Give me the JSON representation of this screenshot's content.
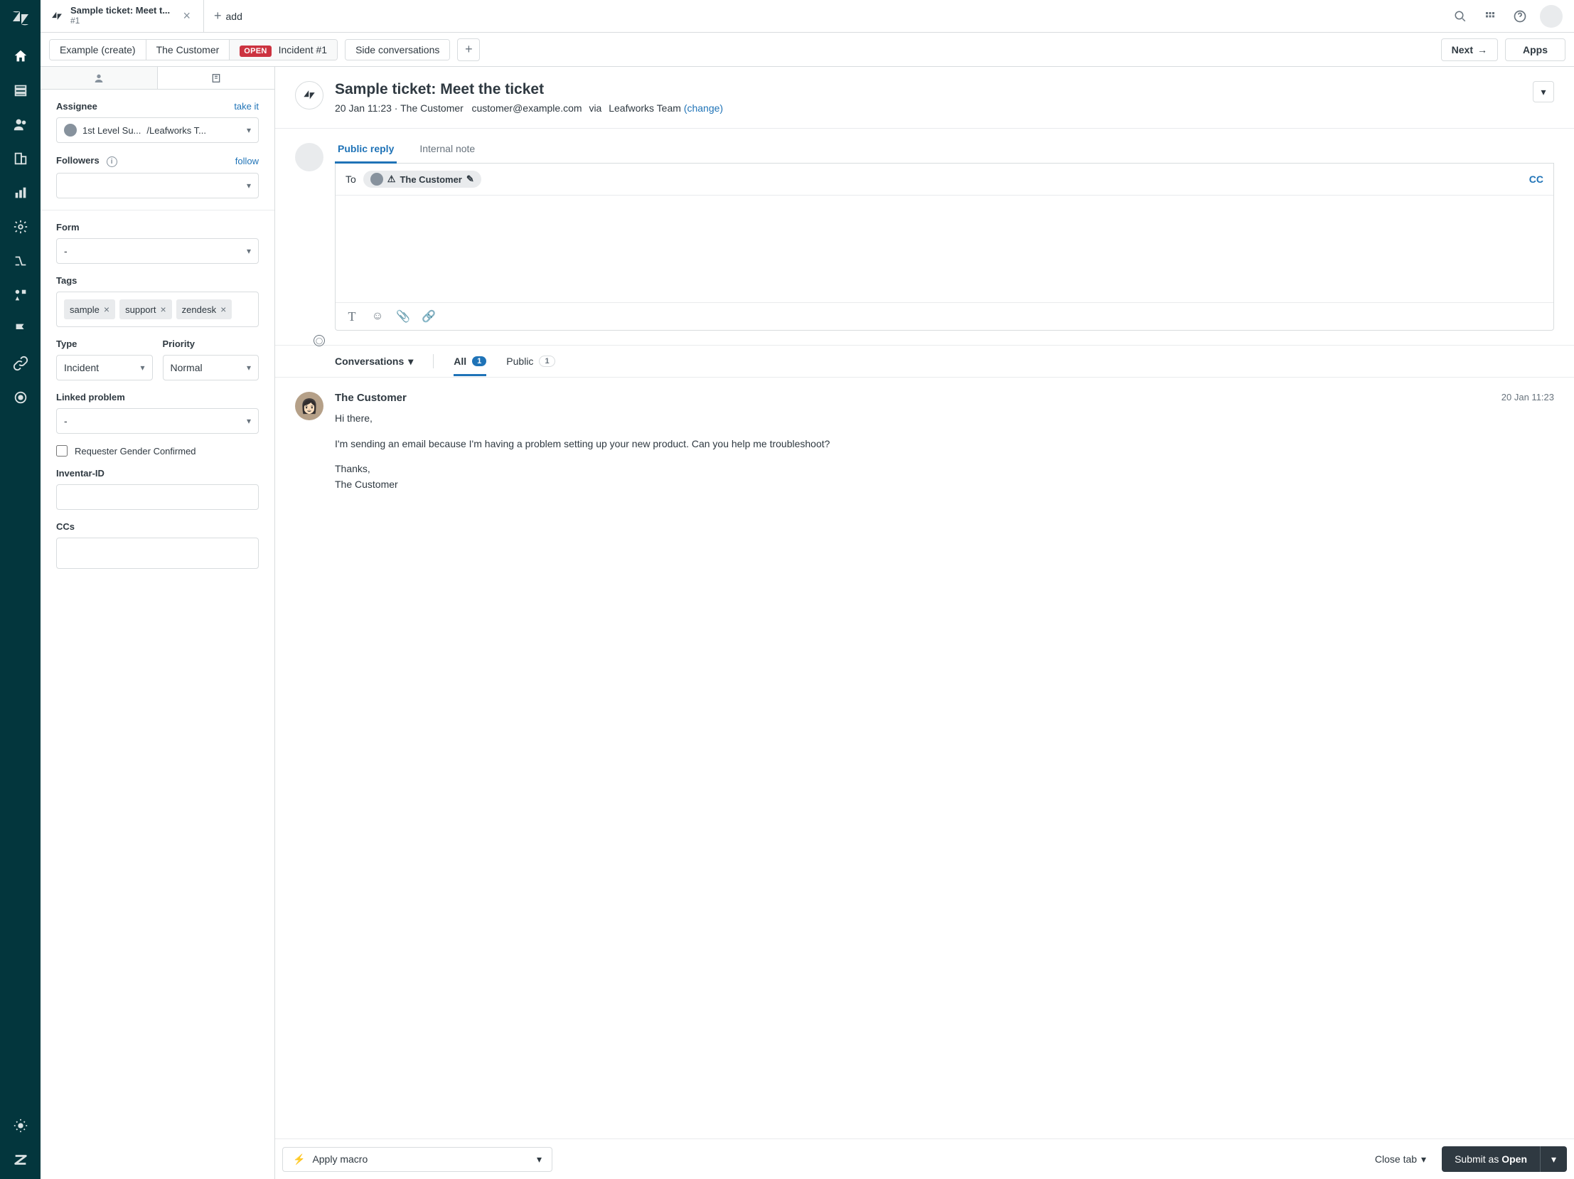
{
  "tab": {
    "title": "Sample ticket: Meet t...",
    "sub": "#1",
    "add_label": "add"
  },
  "secondary": {
    "breadcrumbs": [
      "Example (create)",
      "The Customer"
    ],
    "status": "OPEN",
    "incident": "Incident #1",
    "side_conversations": "Side conversations",
    "next": "Next",
    "apps": "Apps"
  },
  "sidebar": {
    "assignee": {
      "label": "Assignee",
      "take_it": "take it",
      "group": "1st Level Su...",
      "user": "/Leafworks T..."
    },
    "followers": {
      "label": "Followers",
      "follow": "follow"
    },
    "form": {
      "label": "Form",
      "value": "-"
    },
    "tags": {
      "label": "Tags",
      "items": [
        "sample",
        "support",
        "zendesk"
      ]
    },
    "type": {
      "label": "Type",
      "value": "Incident"
    },
    "priority": {
      "label": "Priority",
      "value": "Normal"
    },
    "linked_problem": {
      "label": "Linked problem",
      "value": "-"
    },
    "requester_gender": {
      "label": "Requester Gender Confirmed"
    },
    "inventar_id": {
      "label": "Inventar-ID"
    },
    "ccs": {
      "label": "CCs"
    }
  },
  "ticket": {
    "title": "Sample ticket: Meet the ticket",
    "date": "20 Jan 11:23",
    "customer": "The Customer",
    "email": "customer@example.com",
    "via": "via",
    "via_source": "Leafworks Team",
    "change": "(change)"
  },
  "reply": {
    "tab_public": "Public reply",
    "tab_internal": "Internal note",
    "to_label": "To",
    "recipient": "The Customer",
    "cc": "CC"
  },
  "conversations": {
    "label": "Conversations",
    "all": "All",
    "all_count": "1",
    "public": "Public",
    "public_count": "1"
  },
  "message": {
    "author": "The Customer",
    "time": "20 Jan 11:23",
    "line1": "Hi there,",
    "line2": "I'm sending an email because I'm having a problem setting up your new product. Can you help me troubleshoot?",
    "line3": "Thanks,",
    "line4": "The Customer"
  },
  "footer": {
    "macro": "Apply macro",
    "close_tab": "Close tab",
    "submit_prefix": "Submit as ",
    "submit_status": "Open"
  }
}
